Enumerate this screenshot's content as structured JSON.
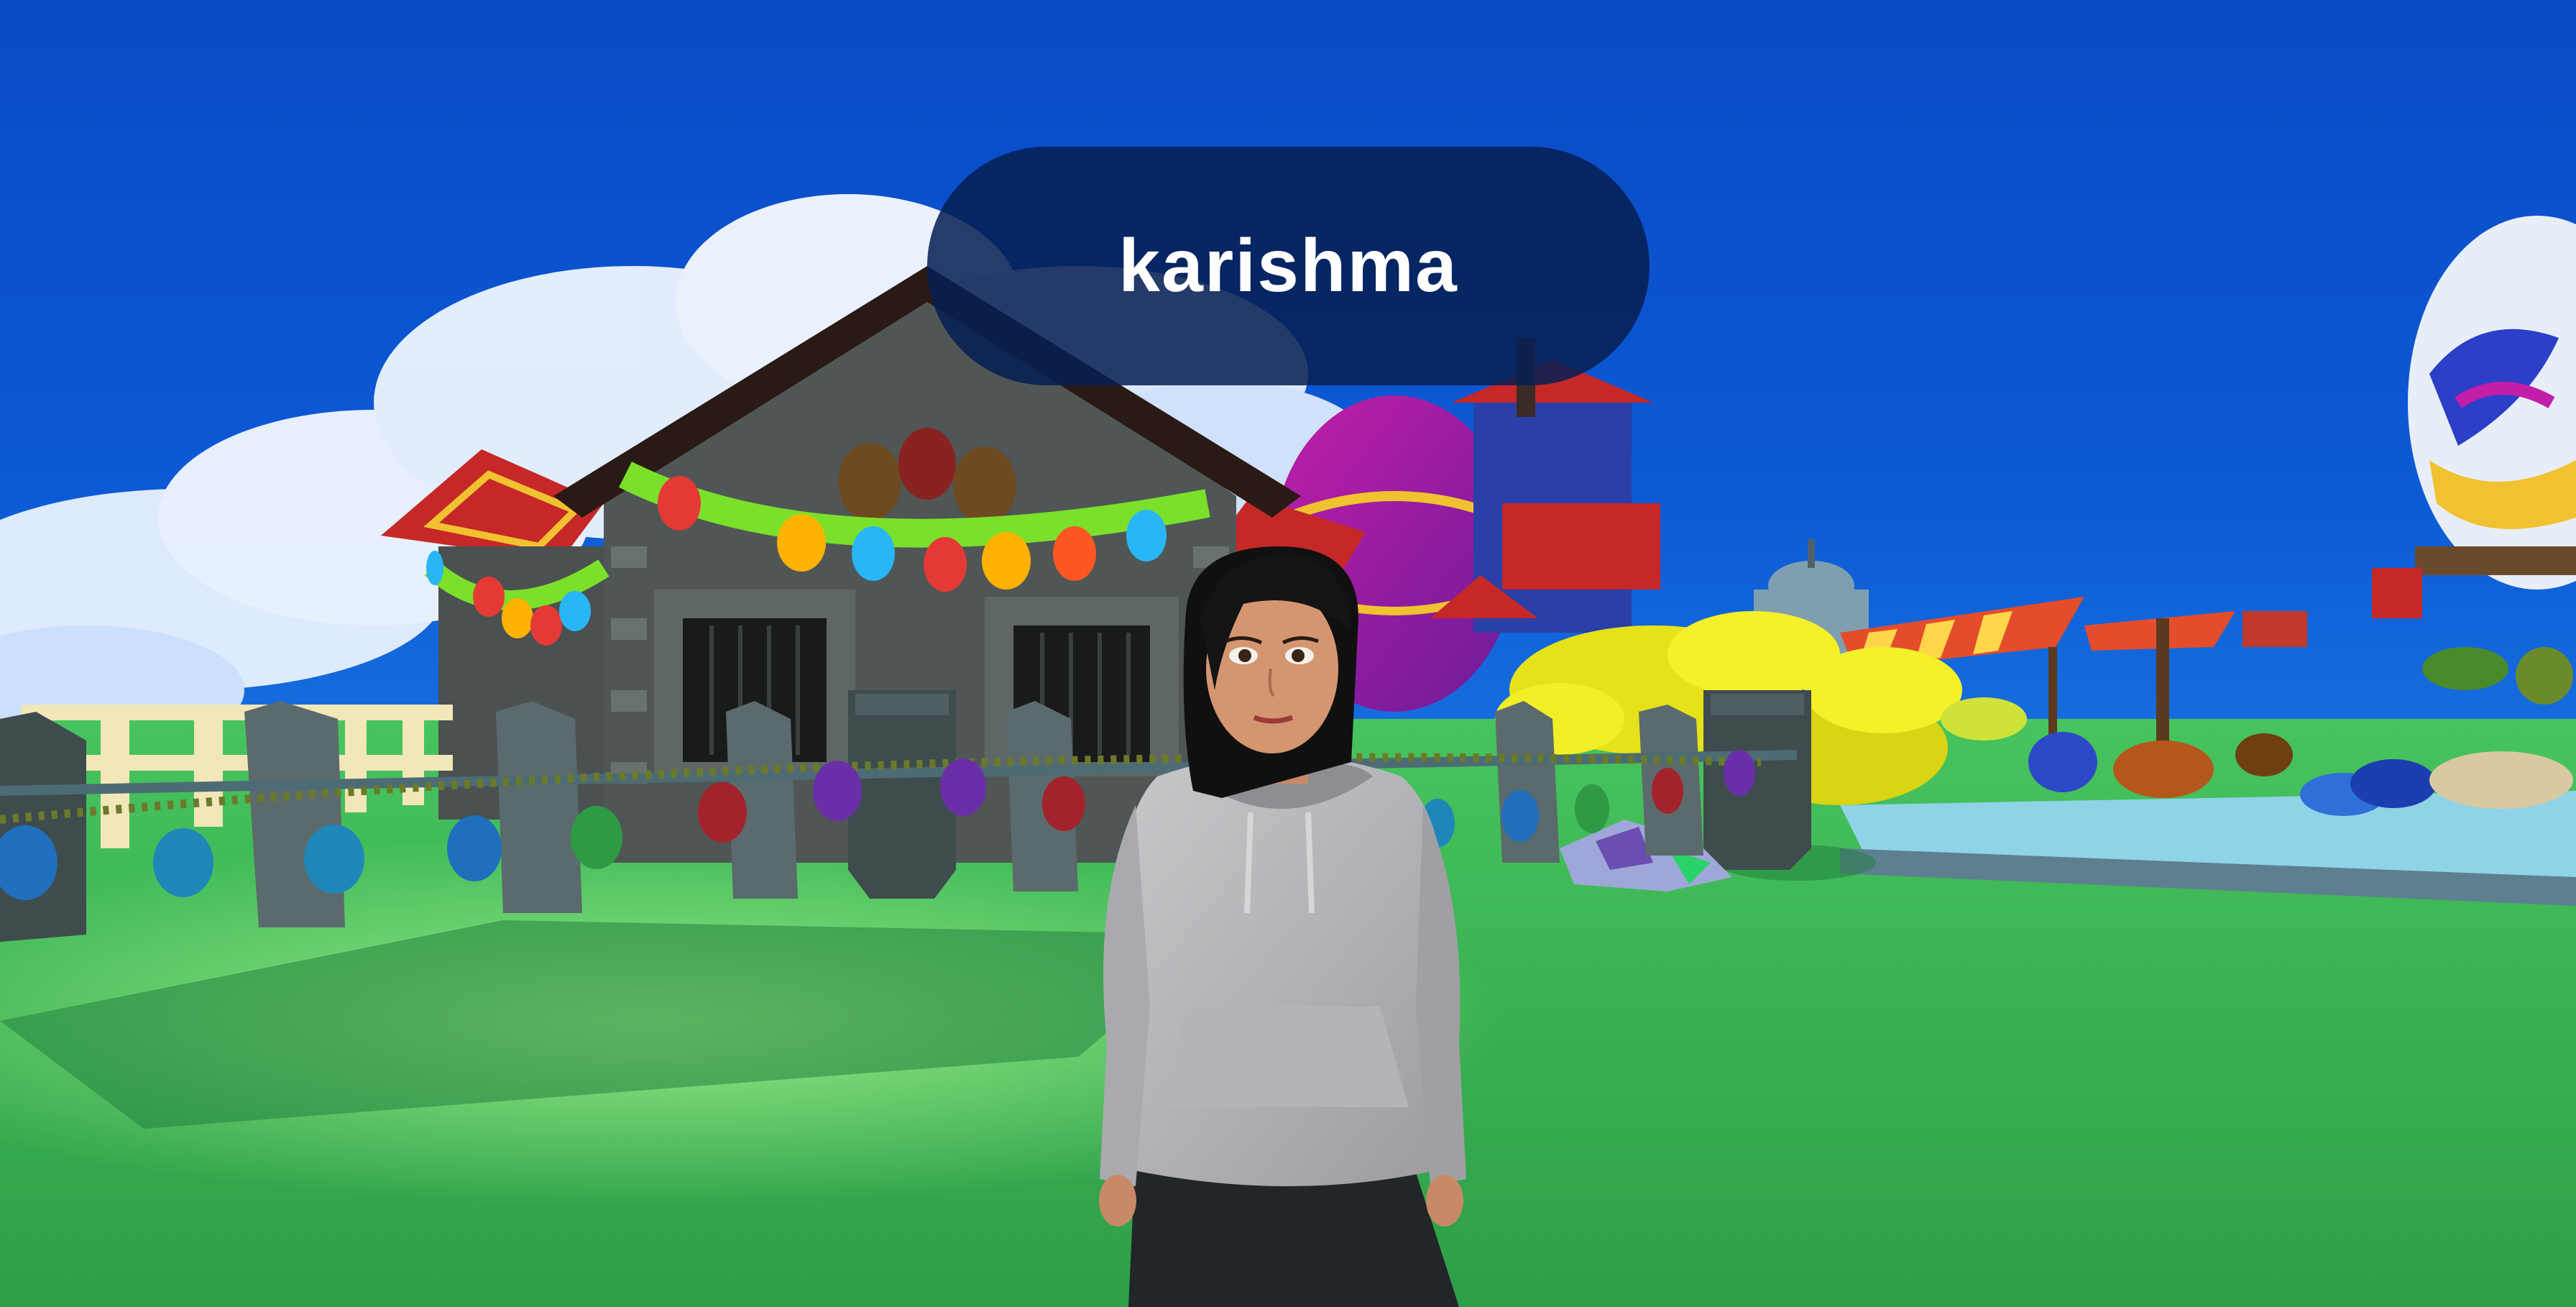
{
  "player": {
    "name_tag": "karishma",
    "avatar": "female-avatar-grey-hoodie"
  },
  "environment": {
    "theme": "easter-village",
    "sky_color": "#0a4fc8",
    "ground_color": "#33a852"
  }
}
